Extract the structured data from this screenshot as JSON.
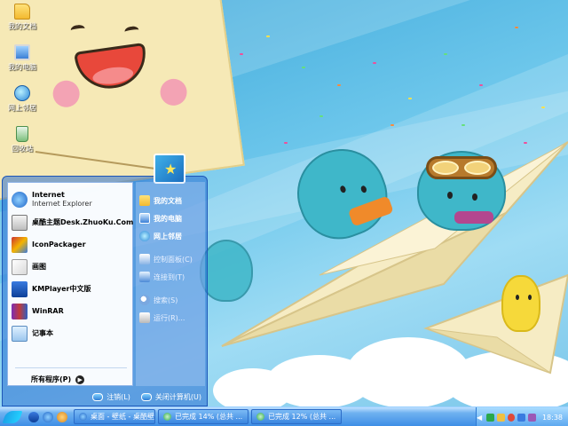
{
  "desktop_icons": [
    {
      "label": "我的文档",
      "icon": "folder-icon"
    },
    {
      "label": "我的电脑",
      "icon": "computer-icon"
    },
    {
      "label": "网上邻居",
      "icon": "network-icon"
    },
    {
      "label": "回收站",
      "icon": "recycle-bin-icon"
    }
  ],
  "start_menu": {
    "programs": [
      {
        "name": "Internet",
        "sub": "Internet Explorer",
        "icon": "internet-explorer-icon"
      },
      {
        "name": "桌酷主题Desk.ZhuoKu.Com",
        "sub": "",
        "icon": "theme-icon"
      },
      {
        "name": "IconPackager",
        "sub": "",
        "icon": "iconpackager-icon"
      },
      {
        "name": "画图",
        "sub": "",
        "icon": "paint-icon"
      },
      {
        "name": "KMPlayer中文版",
        "sub": "",
        "icon": "kmplayer-icon"
      },
      {
        "name": "WinRAR",
        "sub": "",
        "icon": "winrar-icon"
      },
      {
        "name": "记事本",
        "sub": "",
        "icon": "notepad-icon"
      }
    ],
    "all_programs": "所有程序(P)",
    "places": [
      {
        "label": "我的文档",
        "icon": "folder-icon"
      },
      {
        "label": "我的电脑",
        "icon": "computer-icon"
      },
      {
        "label": "网上邻居",
        "icon": "network-icon"
      },
      {
        "label": "控制面板(C)",
        "icon": "control-panel-icon"
      },
      {
        "label": "连接到(T)",
        "icon": "connect-icon"
      },
      {
        "label": "搜索(S)",
        "icon": "search-icon"
      },
      {
        "label": "运行(R)...",
        "icon": "run-icon"
      }
    ],
    "logoff": "注销(L)",
    "shutdown": "关闭计算机(U)"
  },
  "taskbar": {
    "tasks": [
      {
        "label": "桌面 - 壁纸 - 桌酷壁...",
        "icon": "ie-icon"
      },
      {
        "label": "已完成 14% (总共 ...",
        "icon": "download-icon"
      },
      {
        "label": "已完成 12% (总共 ...",
        "icon": "download-icon"
      }
    ],
    "clock": "18:38"
  },
  "colors": {
    "taskbar": "#3e8ee6",
    "sky": "#5bb9e0",
    "start_menu_panel": "#ffffff"
  }
}
